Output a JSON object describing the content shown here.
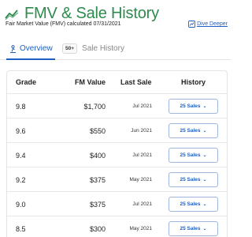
{
  "header": {
    "title": "FMV & Sale History",
    "icon": "trend-line-icon",
    "subtitle": "Fair Market Value (FMV) calculated 07/31/2021",
    "dive_deeper": "Dive Deeper"
  },
  "tabs": {
    "overview": "Overview",
    "sale_history": "Sale History",
    "sale_history_badge": "50+"
  },
  "table": {
    "headers": {
      "grade": "Grade",
      "fm_value": "FM Value",
      "last_sale": "Last Sale",
      "history": "History"
    },
    "rows": [
      {
        "grade": "9.8",
        "fm_value": "$1,700",
        "last_sale": "Jul 2021",
        "history": "25 Sales"
      },
      {
        "grade": "9.6",
        "fm_value": "$550",
        "last_sale": "Jun 2021",
        "history": "25 Sales"
      },
      {
        "grade": "9.4",
        "fm_value": "$400",
        "last_sale": "Jul 2021",
        "history": "25 Sales"
      },
      {
        "grade": "9.2",
        "fm_value": "$375",
        "last_sale": "May 2021",
        "history": "25 Sales"
      },
      {
        "grade": "9.0",
        "fm_value": "$375",
        "last_sale": "Jul 2021",
        "history": "25 Sales"
      },
      {
        "grade": "8.5",
        "fm_value": "$300",
        "last_sale": "May 2021",
        "history": "25 Sales"
      }
    ]
  },
  "colors": {
    "title_green": "#2e8b4e",
    "link_blue": "#1f5fbf"
  }
}
